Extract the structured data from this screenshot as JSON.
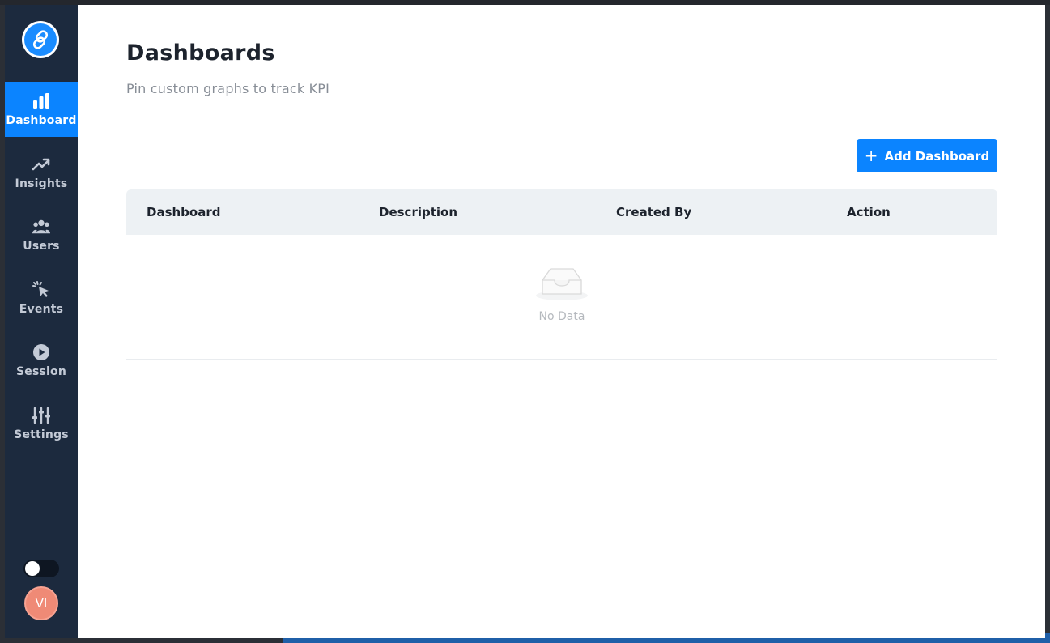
{
  "sidebar": {
    "logo_icon": "link-logo-icon",
    "items": [
      {
        "label": "Dashboard",
        "icon": "bar-chart-icon",
        "active": true
      },
      {
        "label": "Insights",
        "icon": "trending-up-icon",
        "active": false
      },
      {
        "label": "Users",
        "icon": "users-icon",
        "active": false
      },
      {
        "label": "Events",
        "icon": "cursor-click-icon",
        "active": false
      },
      {
        "label": "Session",
        "icon": "play-circle-icon",
        "active": false
      },
      {
        "label": "Settings",
        "icon": "sliders-icon",
        "active": false
      }
    ],
    "theme_toggle_on": false,
    "avatar_initials": "VI"
  },
  "main": {
    "title": "Dashboards",
    "subtitle": "Pin custom graphs to track KPI",
    "add_button_label": "Add Dashboard",
    "table": {
      "columns": [
        "Dashboard",
        "Description",
        "Created By",
        "Action"
      ],
      "rows": [],
      "empty_text": "No Data"
    }
  },
  "colors": {
    "sidebar_bg": "#1c2a3e",
    "accent": "#0b84ff",
    "header_bg": "#edf1f4",
    "avatar_bg": "#ef8a76"
  }
}
